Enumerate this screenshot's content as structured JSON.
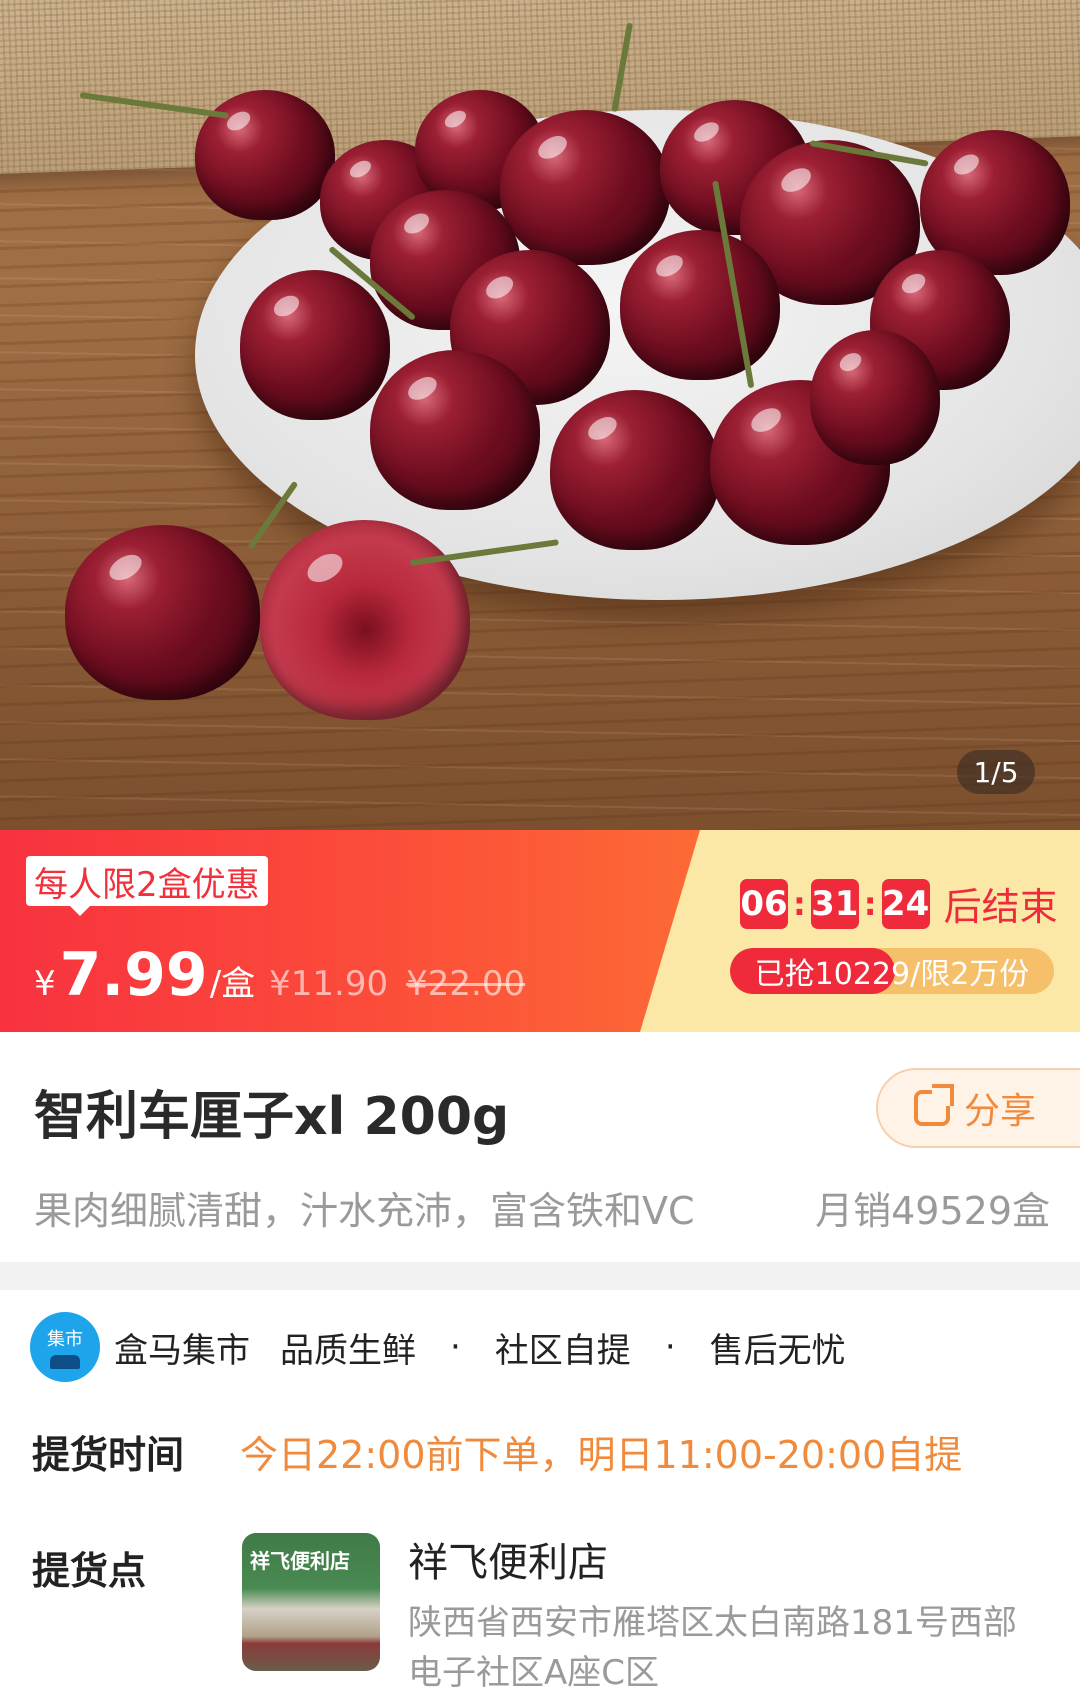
{
  "gallery": {
    "indicator": "1/5"
  },
  "price": {
    "limit_tag": "每人限2盒优惠",
    "currency": "¥",
    "current": "7.99",
    "unit": "/盒",
    "previous": "¥11.90",
    "original": "¥22.00"
  },
  "countdown": {
    "hours": "06",
    "minutes": "31",
    "seconds": "24",
    "separator": ":",
    "suffix": "后结束"
  },
  "sales_progress": {
    "text": "已抢10229/限2万份",
    "fraction": 0.51
  },
  "product": {
    "title": "智利车厘子xl   200g",
    "subtitle": "果肉细腻清甜，汁水充沛，富含铁和VC",
    "monthly_sales": "月销49529盒",
    "share_label": "分享"
  },
  "brand": {
    "logo_text": "集市",
    "name": "盒马集市",
    "features": [
      "品质生鲜",
      "社区自提",
      "售后无忧"
    ],
    "separator": "·"
  },
  "pickup": {
    "time_label": "提货时间",
    "time_value": "今日22:00前下单，明日11:00-20:00自提",
    "point_label": "提货点",
    "store_sign": "祥飞便利店",
    "store_name": "祥飞便利店",
    "store_address": "陕西省西安市雁塔区太白南路181号西部电子社区A座C区"
  }
}
